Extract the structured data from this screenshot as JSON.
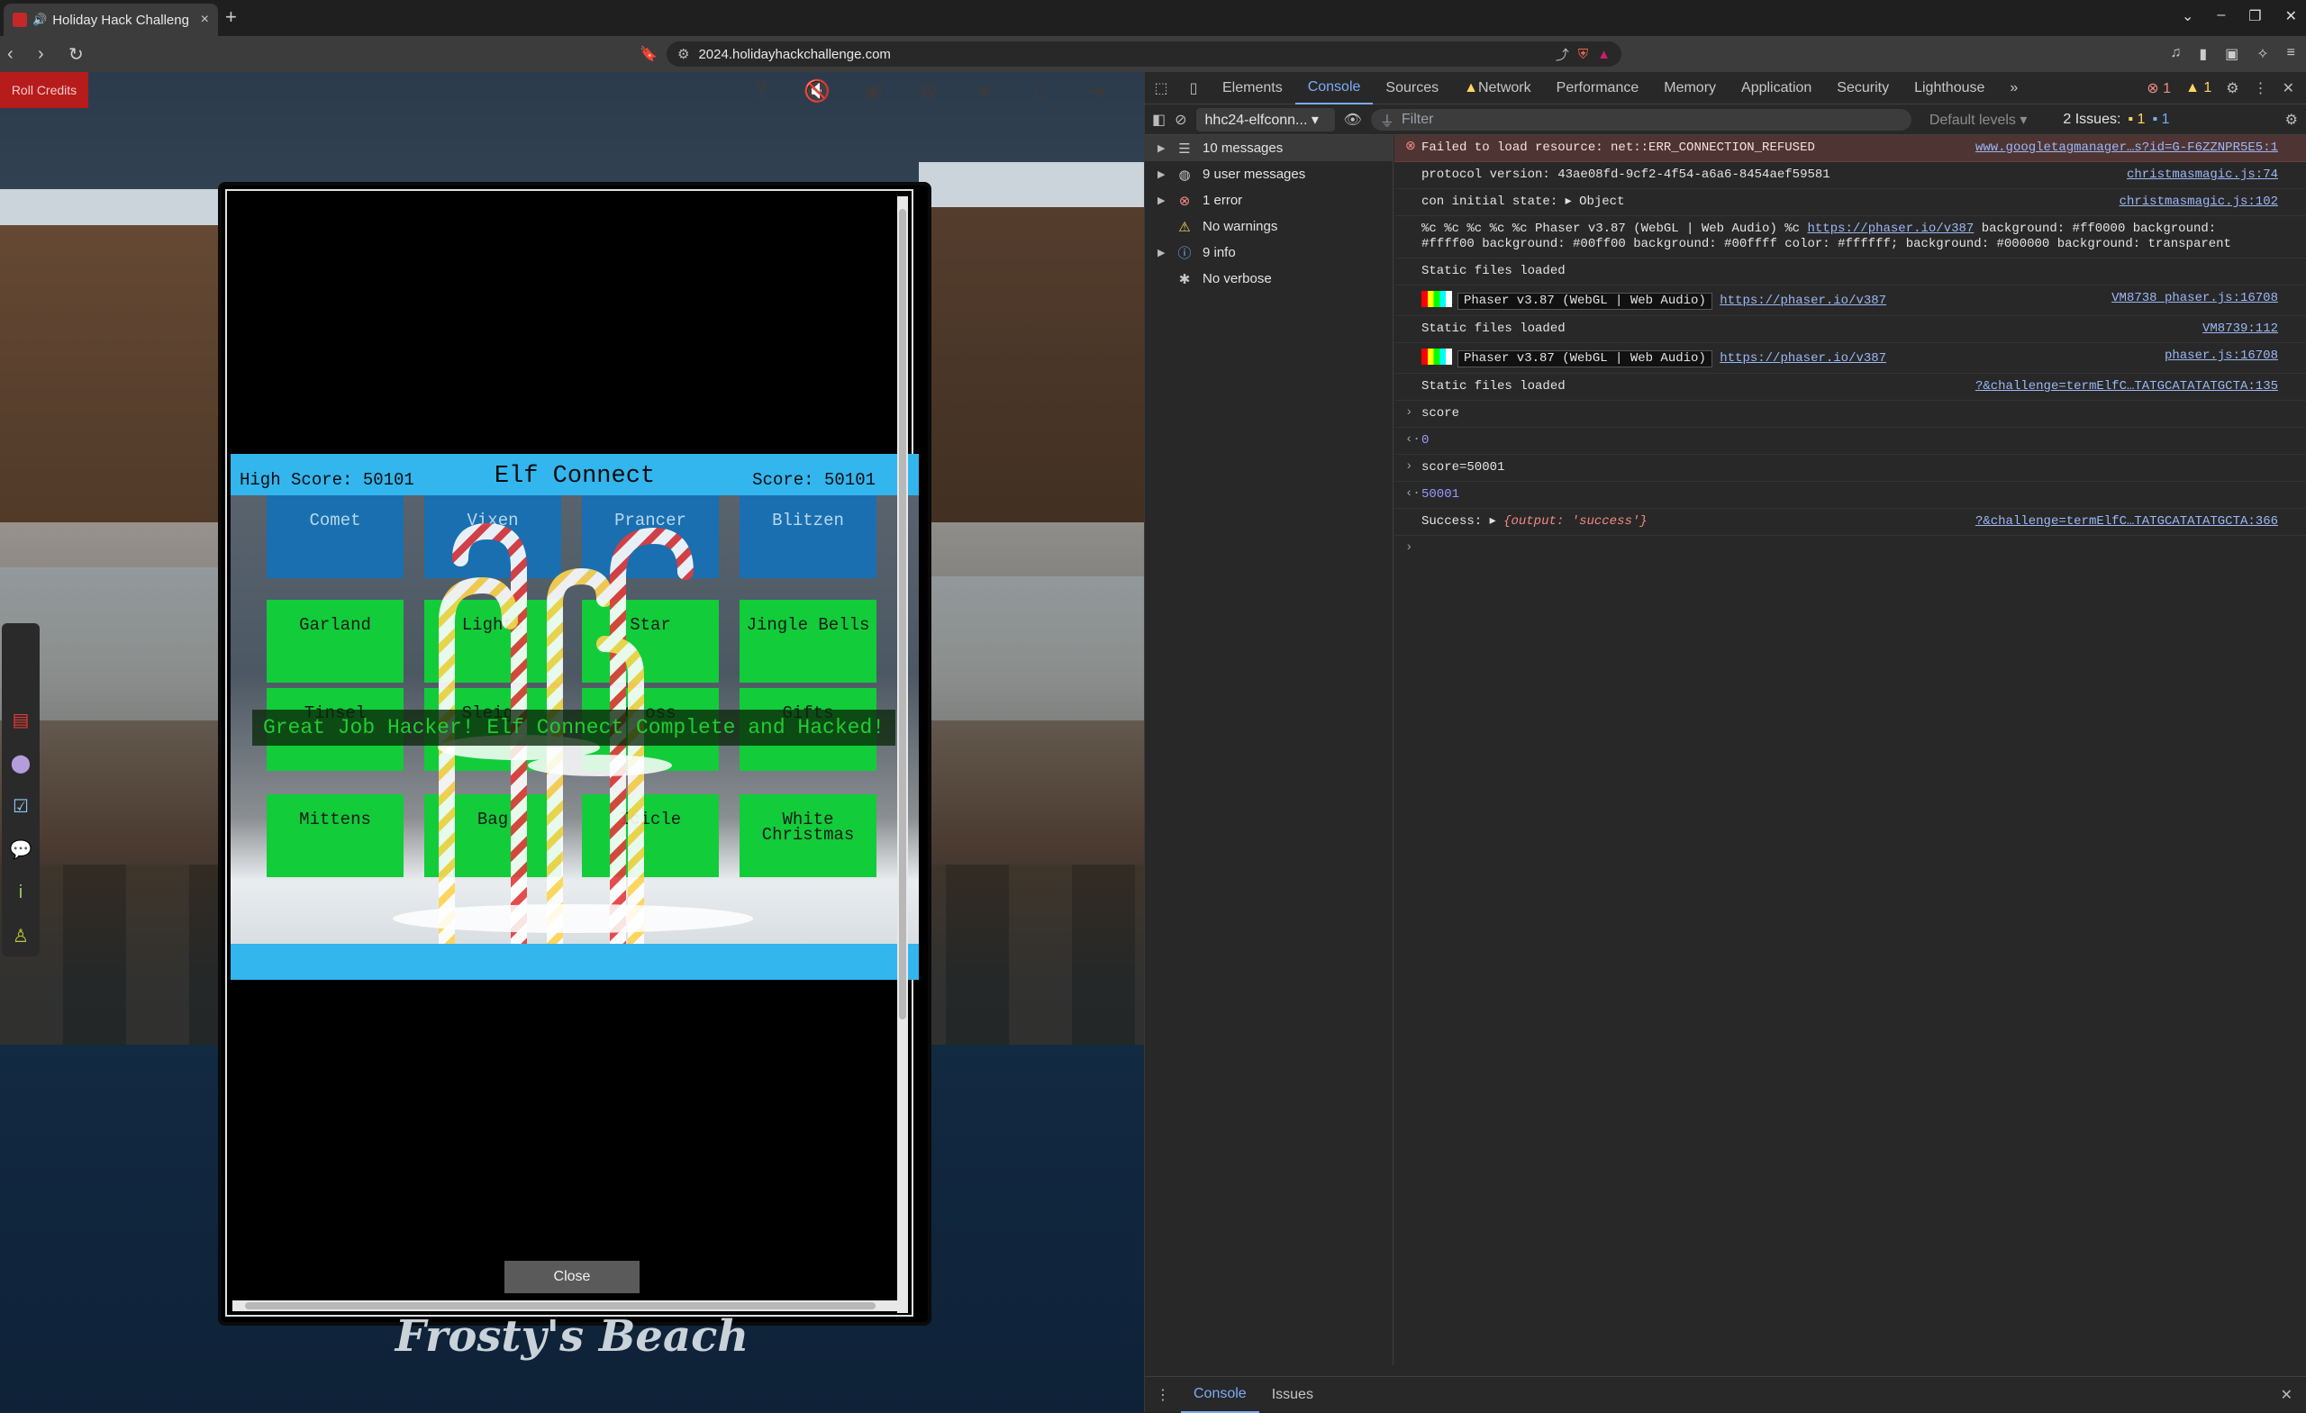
{
  "browser": {
    "tab_title": "Holiday Hack Challeng",
    "url": "2024.holidayhackchallenge.com",
    "new_tab": "+"
  },
  "game": {
    "roll_credits": "Roll Credits",
    "top_icons": [
      "help-icon",
      "mute-icon",
      "discord-icon",
      "settings-icon",
      "profile-icon",
      "home-icon",
      "logout-icon"
    ],
    "side_icons": [
      "book-icon",
      "map-pin-icon",
      "objectives-icon",
      "chat-icon",
      "info-icon",
      "badge-icon"
    ],
    "close_label": "Close",
    "location_name": "Frosty's Beach"
  },
  "elf_connect": {
    "high_score_label": "High Score: 50101",
    "title": "Elf Connect",
    "score_label": "Score: 50101",
    "banner": "Great Job Hacker! Elf Connect Complete and Hacked!",
    "tiles": [
      {
        "label": "Comet",
        "color": "blue"
      },
      {
        "label": "Vixen",
        "color": "blue"
      },
      {
        "label": "Prancer",
        "color": "blue"
      },
      {
        "label": "Blitzen",
        "color": "blue"
      },
      {
        "label": "Garland",
        "color": "green"
      },
      {
        "label": "Lights",
        "color": "green"
      },
      {
        "label": "Star",
        "color": "green"
      },
      {
        "label": "Jingle Bells",
        "color": "green"
      },
      {
        "label": "Tinsel",
        "color": "green"
      },
      {
        "label": "Sleigh",
        "color": "green"
      },
      {
        "label": "Cross",
        "color": "green"
      },
      {
        "label": "Gifts",
        "color": "green"
      },
      {
        "label": "Mittens",
        "color": "green"
      },
      {
        "label": "Bag",
        "color": "green"
      },
      {
        "label": "Icicle",
        "color": "green"
      },
      {
        "label": "White Christmas",
        "color": "green"
      }
    ]
  },
  "devtools": {
    "tabs": [
      "Elements",
      "Console",
      "Sources",
      "Network",
      "Performance",
      "Memory",
      "Application",
      "Security",
      "Lighthouse"
    ],
    "active_tab": "Console",
    "error_count": "1",
    "warning_count": "1",
    "context": "hhc24-elfconn...",
    "filter_placeholder": "Filter",
    "levels": "Default levels",
    "issues_label": "2 Issues:",
    "issues_errors": "1",
    "issues_info": "1",
    "sidebar": [
      {
        "label": "10 messages",
        "icon": "list-icon",
        "expandable": true
      },
      {
        "label": "9 user messages",
        "icon": "user-icon",
        "expandable": true
      },
      {
        "label": "1 error",
        "icon": "error-icon",
        "expandable": true
      },
      {
        "label": "No warnings",
        "icon": "warning-icon",
        "expandable": false
      },
      {
        "label": "9 info",
        "icon": "info-icon",
        "expandable": true
      },
      {
        "label": "No verbose",
        "icon": "bug-icon",
        "expandable": false
      }
    ],
    "console": {
      "err_text": "Failed to load resource: net::ERR_CONNECTION_REFUSED",
      "err_src": "www.googletagmanager…s?id=G-F6ZZNPR5E5:1",
      "proto_text": "protocol version: 43ae08fd-9cf2-4f54-a6a6-8454aef59581",
      "proto_src": "christmasmagic.js:74",
      "con_text": "con initial state:",
      "con_obj": "Object",
      "con_src": "christmasmagic.js:102",
      "phaser_fmt_pre": "%c %c %c %c %c Phaser v3.87 (WebGL | Web Audio) %c ",
      "phaser_link": "https://phaser.io/v387",
      "phaser_fmt_post": " background: #ff0000 background: #ffff00 background: #00ff00 background: #00ffff color: #ffffff; background: #000000 background: transparent",
      "static1": "Static files loaded",
      "phaser_pill": "Phaser v3.87 (WebGL | Web Audio)",
      "banner1_src": "VM8738 phaser.js:16708",
      "static2": "Static files loaded",
      "static2_src": "VM8739:112",
      "banner2_src": "phaser.js:16708",
      "static3": "Static files loaded",
      "static3_src": "?&challenge=termElfC…TATGCATATATGCTA:135",
      "in1": "score",
      "out1": "0",
      "in2": "score=50001",
      "out2": "50001",
      "success_label": "Success:",
      "success_obj": "{output: 'success'}",
      "success_src": "?&challenge=termElfC…TATGCATATATGCTA:366"
    },
    "drawer_tabs": [
      "Console",
      "Issues"
    ]
  }
}
